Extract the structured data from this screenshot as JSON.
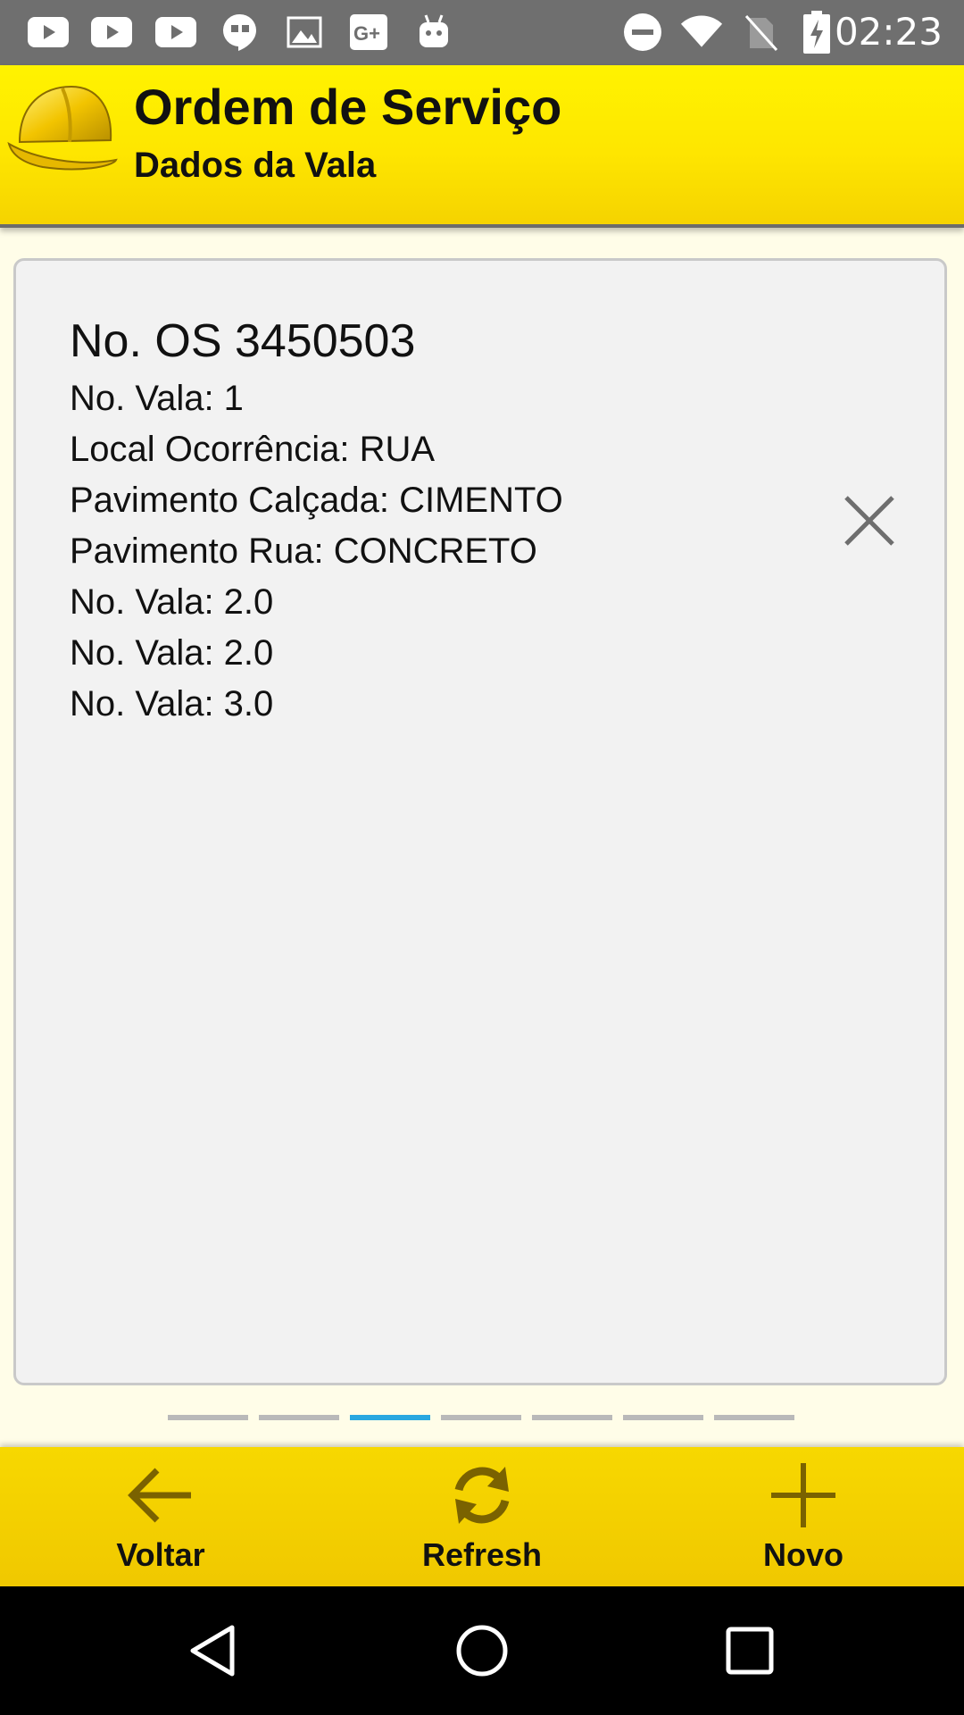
{
  "status_bar": {
    "time": "02:23",
    "left_icons": [
      "youtube-icon",
      "youtube-icon",
      "youtube-icon",
      "hangouts-icon",
      "image-icon",
      "google-plus-icon",
      "android-icon"
    ],
    "right_icons": [
      "do-not-disturb-icon",
      "wifi-icon",
      "no-sim-icon",
      "battery-charging-icon"
    ]
  },
  "header": {
    "title": "Ordem de Serviço",
    "subtitle": "Dados da Vala",
    "logo_icon": "hard-hat-icon",
    "background_color": "#fee600"
  },
  "card": {
    "title": "No. OS 3450503",
    "lines": [
      "No. Vala: 1",
      "Local Ocorrência: RUA",
      "Pavimento Calçada: CIMENTO",
      "Pavimento Rua: CONCRETO",
      "No. Vala: 2.0",
      "No. Vala: 2.0",
      "No. Vala: 3.0"
    ],
    "close_icon": "close-icon"
  },
  "pager": {
    "total": 7,
    "active_index": 2,
    "active_color": "#29a7e0"
  },
  "actions": {
    "back": {
      "label": "Voltar",
      "icon": "arrow-left-icon"
    },
    "refresh": {
      "label": "Refresh",
      "icon": "refresh-icon"
    },
    "new": {
      "label": "Novo",
      "icon": "plus-icon"
    }
  },
  "navbar": {
    "icons": [
      "back-triangle-icon",
      "home-circle-icon",
      "recents-square-icon"
    ]
  }
}
